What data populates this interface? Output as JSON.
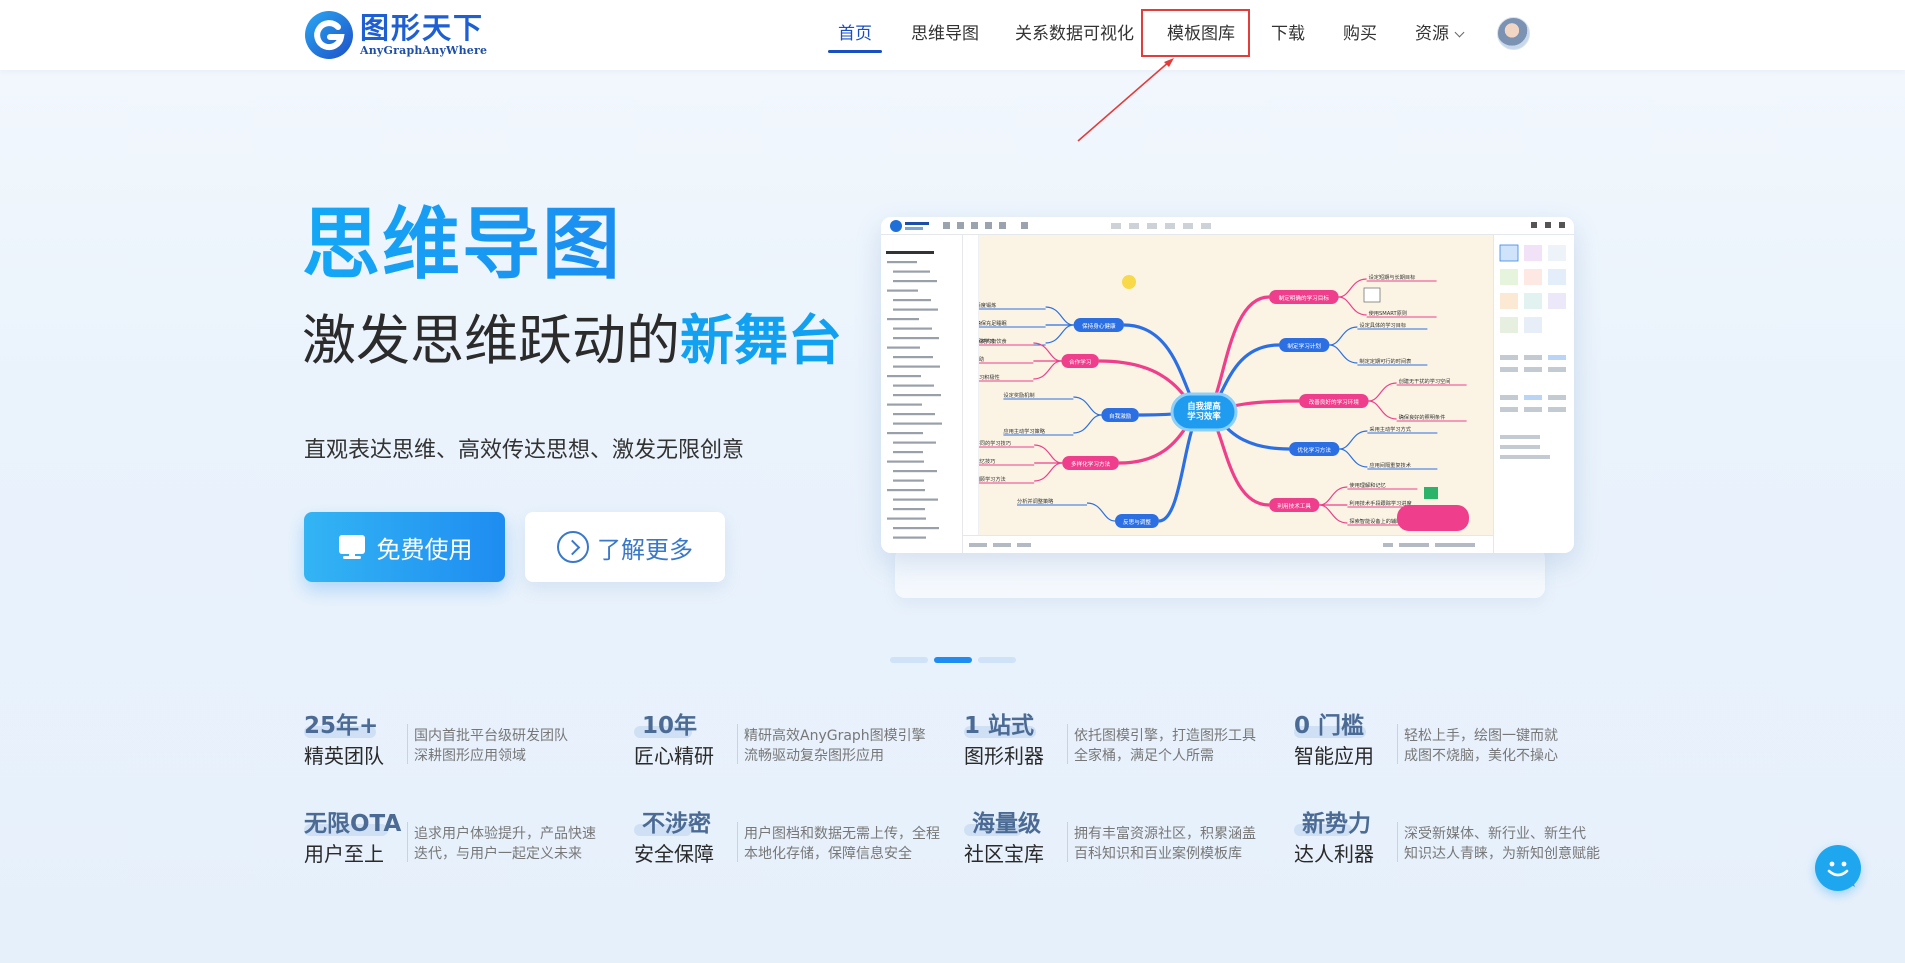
{
  "header": {
    "logo_cn": "图形天下",
    "logo_en": "AnyGraphAnyWhere",
    "nav": [
      {
        "label": "首页",
        "active": true
      },
      {
        "label": "思维导图"
      },
      {
        "label": "关系数据可视化"
      },
      {
        "label": "模板图库",
        "highlighted": true
      },
      {
        "label": "下载"
      },
      {
        "label": "购买"
      },
      {
        "label": "资源",
        "has_dropdown": true
      }
    ]
  },
  "hero": {
    "title": "思维导图",
    "subtitle_plain": "激发思维跃动的",
    "subtitle_highlight": "新舞台",
    "description": "直观表达思维、高效传达思想、激发无限创意",
    "primary_button": "免费使用",
    "secondary_button": "了解更多"
  },
  "mindmap": {
    "center": "自我提高\n学习效率",
    "branches_left": [
      "保持身心健康",
      "合作学习",
      "自我激励",
      "多样化学习方法",
      "反思与调整"
    ],
    "branches_right": [
      "制定明确的学习目标",
      "制定学习计划",
      "改善良好的学习环境",
      "优化学习方法",
      "利用技术工具"
    ],
    "leaves": [
      "设定短期与长期目标",
      "使用SMART原则",
      "设定具体的学习目标",
      "制定定期可行的时间表",
      "创建无干扰的学习空间",
      "确保良好的照明条件",
      "采用主动学习方式",
      "应用间隔重复技术",
      "使用理解和记忆",
      "利用技术手段跟踪学习进度",
      "探索智能设备上的辅助工具",
      "适度锻炼",
      "确保充足睡眠",
      "保持均衡饮食",
      "参与集体学习",
      "寻求帮助",
      "激励学习积极性",
      "设定奖励机制",
      "应用主动学习策略",
      "尝试不同的学习技巧",
      "使用记忆技巧",
      "定期回顾学习方法",
      "分析并调整策略"
    ]
  },
  "stats": [
    {
      "big": "25年+",
      "name": "精英团队",
      "desc": [
        "国内首批平台级研发团队",
        "深耕图形应用领域"
      ]
    },
    {
      "big": "10年",
      "name": "匠心精研",
      "desc": [
        "精研高效AnyGraph图模引擎",
        "流畅驱动复杂图形应用"
      ]
    },
    {
      "big": "1 站式",
      "name": "图形利器",
      "desc": [
        "依托图模引擎，打造图形工具",
        "全家桶，满足个人所需"
      ]
    },
    {
      "big": "0 门槛",
      "name": "智能应用",
      "desc": [
        "轻松上手，绘图一键而就",
        "成图不烧脑，美化不操心"
      ]
    },
    {
      "big": "无限OTA",
      "name": "用户至上",
      "desc": [
        "追求用户体验提升，产品快速",
        "迭代，与用户一起定义未来"
      ]
    },
    {
      "big": "不涉密",
      "name": "安全保障",
      "desc": [
        "用户图档和数据无需上传，全程",
        "本地化存储，保障信息安全"
      ]
    },
    {
      "big": "海量级",
      "name": "社区宝库",
      "desc": [
        "拥有丰富资源社区，积累涵盖",
        "百科知识和百业案例模板库"
      ]
    },
    {
      "big": "新势力",
      "name": "达人利器",
      "desc": [
        "深受新媒体、新行业、新生代",
        "知识达人青睐，为新知创意赋能"
      ]
    }
  ],
  "colors": {
    "brand": "#1a4fc2",
    "accent": "#14a8f6",
    "highlight_box": "#e43b3b"
  }
}
